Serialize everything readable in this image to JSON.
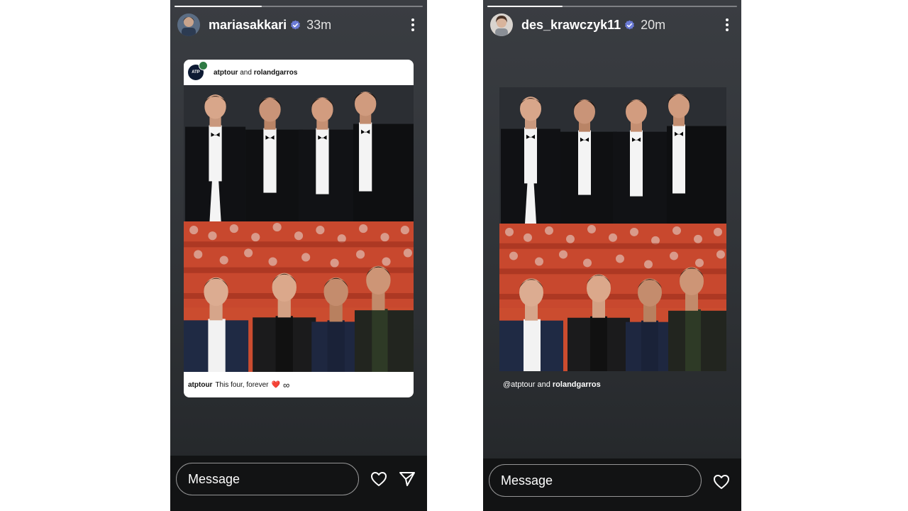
{
  "stories": [
    {
      "username": "mariasakkari",
      "time": "33m",
      "progress": 0.35,
      "card": {
        "account1": "atptour",
        "connector": "and",
        "account2": "rolandgarros",
        "logo_text": "ATP",
        "caption_user": "atptour",
        "caption_text": "This four, forever",
        "caption_emoji": "❤️",
        "caption_symbol": "∞"
      },
      "message_placeholder": "Message",
      "icons": [
        "verified-badge-icon",
        "more-options-icon",
        "heart-icon",
        "send-icon"
      ]
    },
    {
      "username": "des_krawczyk11",
      "time": "20m",
      "progress": 0.3,
      "tag_line": {
        "account1": "@atptour",
        "connector": "and",
        "account2": "rolandgarros"
      },
      "message_placeholder": "Message",
      "icons": [
        "verified-badge-icon",
        "more-options-icon",
        "heart-icon"
      ]
    }
  ],
  "colors": {
    "verified": "#6b7bd6",
    "heart": "#d32f3c",
    "story_bg": "#33363a"
  }
}
